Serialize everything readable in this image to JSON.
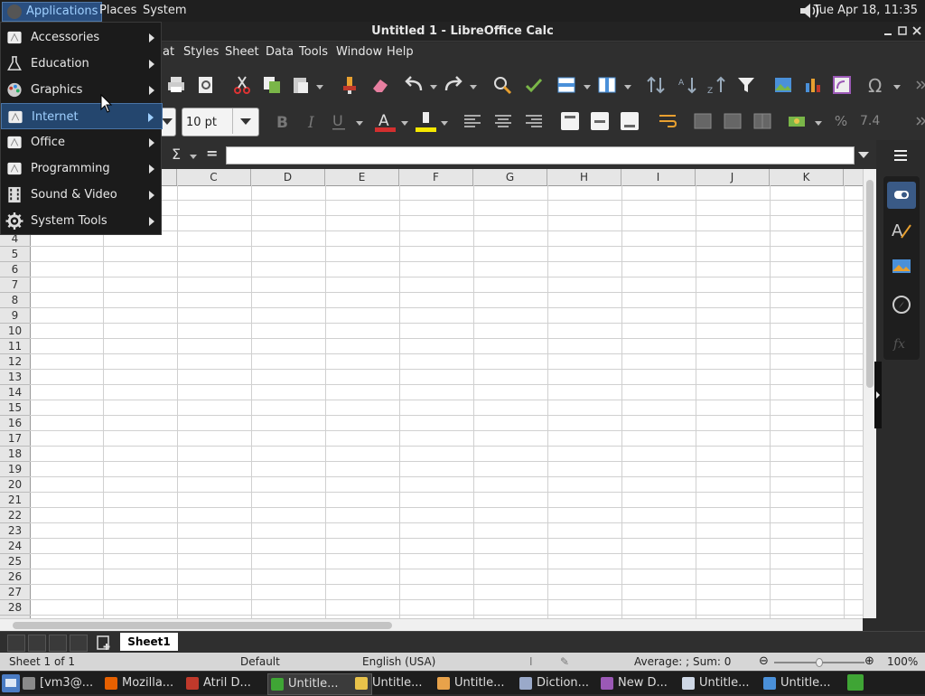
{
  "top_panel": {
    "applications": "Applications",
    "places": "Places",
    "system": "System",
    "clock": "Tue Apr 18, 11:35"
  },
  "window": {
    "title": "Untitled 1 - LibreOffice Calc"
  },
  "menubar": {
    "items": [
      "at",
      "Styles",
      "Sheet",
      "Data",
      "Tools",
      "Window",
      "Help"
    ]
  },
  "toolbar": {
    "font_size": "10 pt",
    "percent_label": "%",
    "number_label": "7.4"
  },
  "formula_bar": {
    "sum_symbol": "Σ",
    "equals_symbol": "="
  },
  "grid": {
    "columns": [
      "C",
      "D",
      "E",
      "F",
      "G",
      "H",
      "I",
      "J",
      "K"
    ],
    "rows": [
      "4",
      "5",
      "6",
      "7",
      "8",
      "9",
      "10",
      "11",
      "12",
      "13",
      "14",
      "15",
      "16",
      "17",
      "18",
      "19",
      "20",
      "21",
      "22",
      "23",
      "24",
      "25",
      "26",
      "27",
      "28"
    ]
  },
  "sheet_tabs": {
    "active": "Sheet1"
  },
  "status_bar": {
    "sheet_info": "Sheet 1 of 1",
    "page_style": "Default",
    "language": "English (USA)",
    "calc_result": "Average: ; Sum: 0",
    "zoom": "100%",
    "zoom_level": 0.5
  },
  "taskbar": {
    "items": [
      {
        "label": "[vm3@...",
        "icon": "terminal-icon",
        "color": "#8a8a8a"
      },
      {
        "label": "Mozilla...",
        "icon": "firefox-icon",
        "color": "#e66000"
      },
      {
        "label": "Atril D...",
        "icon": "atril-icon",
        "color": "#c0392b"
      },
      {
        "label": "Untitle...",
        "icon": "calc-icon",
        "color": "#3fa535"
      },
      {
        "label": "Untitle...",
        "icon": "document-icon",
        "color": "#e8c24a"
      },
      {
        "label": "Untitle...",
        "icon": "document-icon",
        "color": "#e8a24a"
      },
      {
        "label": "Diction...",
        "icon": "dictionary-icon",
        "color": "#9aa9c9"
      },
      {
        "label": "New D...",
        "icon": "draw-icon",
        "color": "#9b59b6"
      },
      {
        "label": "Untitle...",
        "icon": "writer-icon",
        "color": "#cfd8e6"
      },
      {
        "label": "Untitle...",
        "icon": "writer-icon",
        "color": "#4a90d9"
      }
    ]
  },
  "apps_menu": {
    "items": [
      {
        "label": "Accessories",
        "icon": "accessories-icon"
      },
      {
        "label": "Education",
        "icon": "education-icon"
      },
      {
        "label": "Graphics",
        "icon": "graphics-icon"
      },
      {
        "label": "Internet",
        "icon": "internet-icon",
        "highlighted": true
      },
      {
        "label": "Office",
        "icon": "office-icon"
      },
      {
        "label": "Programming",
        "icon": "programming-icon"
      },
      {
        "label": "Sound & Video",
        "icon": "sound-video-icon"
      },
      {
        "label": "System Tools",
        "icon": "system-tools-icon"
      }
    ]
  },
  "colors": {
    "highlight": "#24466e",
    "highlight_text": "#9fd0ff",
    "font_color": "#d32f2f",
    "highlight_color": "#f5e800"
  }
}
